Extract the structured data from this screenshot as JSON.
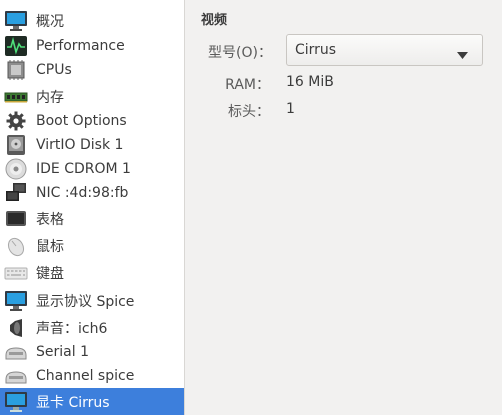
{
  "sidebar": {
    "items": [
      {
        "label": "概况",
        "icon": "monitor-icon"
      },
      {
        "label": "Performance",
        "icon": "performance-graph-icon"
      },
      {
        "label": "CPUs",
        "icon": "cpu-chip-icon"
      },
      {
        "label": "内存",
        "icon": "memory-module-icon"
      },
      {
        "label": "Boot Options",
        "icon": "gear-icon"
      },
      {
        "label": "VirtIO Disk 1",
        "icon": "hard-disk-icon"
      },
      {
        "label": "IDE CDROM 1",
        "icon": "cdrom-icon"
      },
      {
        "label": "NIC :4d:98:fb",
        "icon": "network-icon"
      },
      {
        "label": "表格",
        "icon": "tablet-icon"
      },
      {
        "label": "鼠标",
        "icon": "mouse-icon"
      },
      {
        "label": "键盘",
        "icon": "keyboard-icon"
      },
      {
        "label": "显示协议 Spice",
        "icon": "display-monitor-icon"
      },
      {
        "label": "声音：ich6",
        "icon": "speaker-icon"
      },
      {
        "label": "Serial 1",
        "icon": "serial-port-icon"
      },
      {
        "label": "Channel spice",
        "icon": "channel-port-icon"
      },
      {
        "label": "显卡 Cirrus",
        "icon": "video-card-monitor-icon",
        "selected": true
      }
    ]
  },
  "details": {
    "section_title": "视频",
    "model_label": "型号(O)：",
    "model_value": "Cirrus",
    "ram_label": "RAM：",
    "ram_value": "16 MiB",
    "heads_label": "标头：",
    "heads_value": "1"
  },
  "colors": {
    "selection": "#3d7fdc",
    "panel_bg": "#f2f1f0",
    "list_bg": "#ffffff"
  }
}
